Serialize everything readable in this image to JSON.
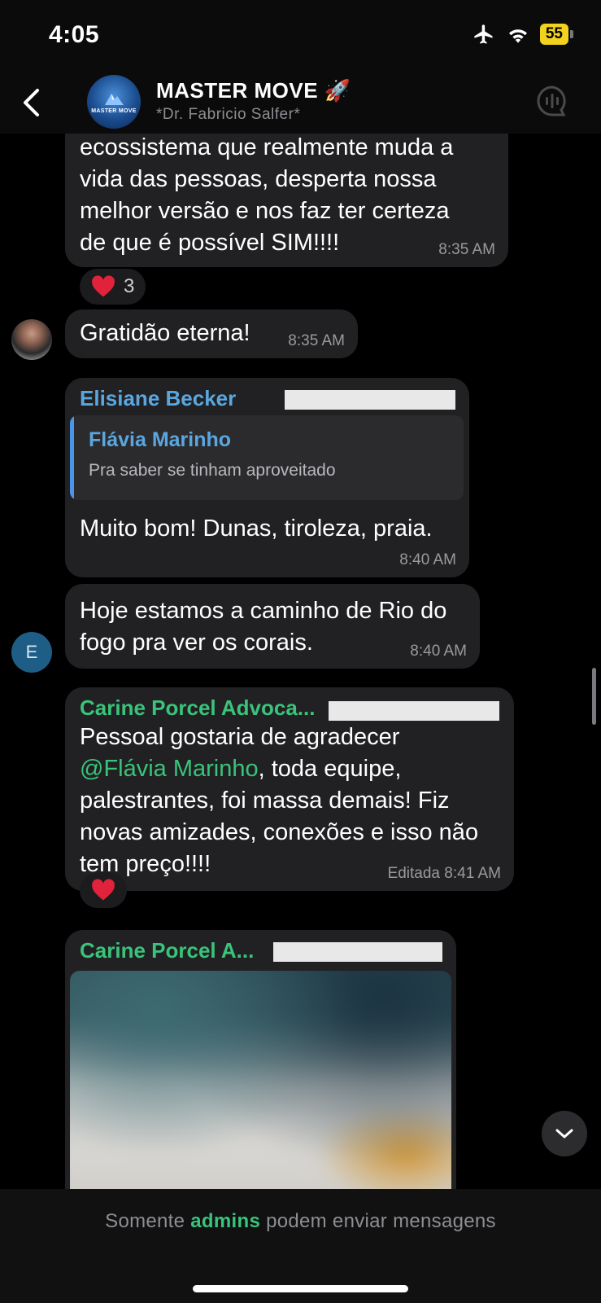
{
  "status_bar": {
    "time": "4:05",
    "battery": "55"
  },
  "header": {
    "title": "MASTER MOVE 🚀",
    "subtitle": "*Dr. Fabricio Salfer*",
    "avatar_text": "MASTER MOVE"
  },
  "messages": {
    "m1": {
      "lines": [
        "ecossistema que realmente muda a",
        "vida das pessoas, desperta nossa",
        "melhor versão e nos faz ter certeza",
        "de que é possível SIM!!!!"
      ],
      "time": "8:35 AM",
      "reaction_count": "3"
    },
    "m2": {
      "text": "Gratidão eterna!",
      "time": "8:35 AM"
    },
    "m3": {
      "sender": "Elisiane Becker",
      "quote_sender": "Flávia Marinho",
      "quote_text": "Pra saber se tinham aproveitado",
      "text": "Muito bom! Dunas, tiroleza,  praia.",
      "time": "8:40 AM"
    },
    "m4": {
      "avatar_letter": "E",
      "lines": [
        "Hoje estamos a caminho de Rio do",
        "fogo pra ver os corais."
      ],
      "time": "8:40 AM"
    },
    "m5": {
      "sender": "Carine Porcel Advoca...",
      "line1": "Pessoal gostaria de agradecer",
      "mention": "@Flávia Marinho",
      "line2_rest": ", toda equipe,",
      "line3": "palestrantes, foi massa demais! Fiz",
      "line4": "novas amizades, conexões e isso não",
      "line5": "tem preço!!!!",
      "time": "Editada 8:41 AM"
    },
    "m6": {
      "sender": "Carine Porcel A..."
    }
  },
  "colors": {
    "sender_blue": "#5aa7e0",
    "sender_green": "#3ac37a",
    "bubble": "#212123",
    "heart": "#e0223a"
  },
  "footer": {
    "prefix": "Somente",
    "admins": "admins",
    "suffix": "podem enviar mensagens"
  }
}
